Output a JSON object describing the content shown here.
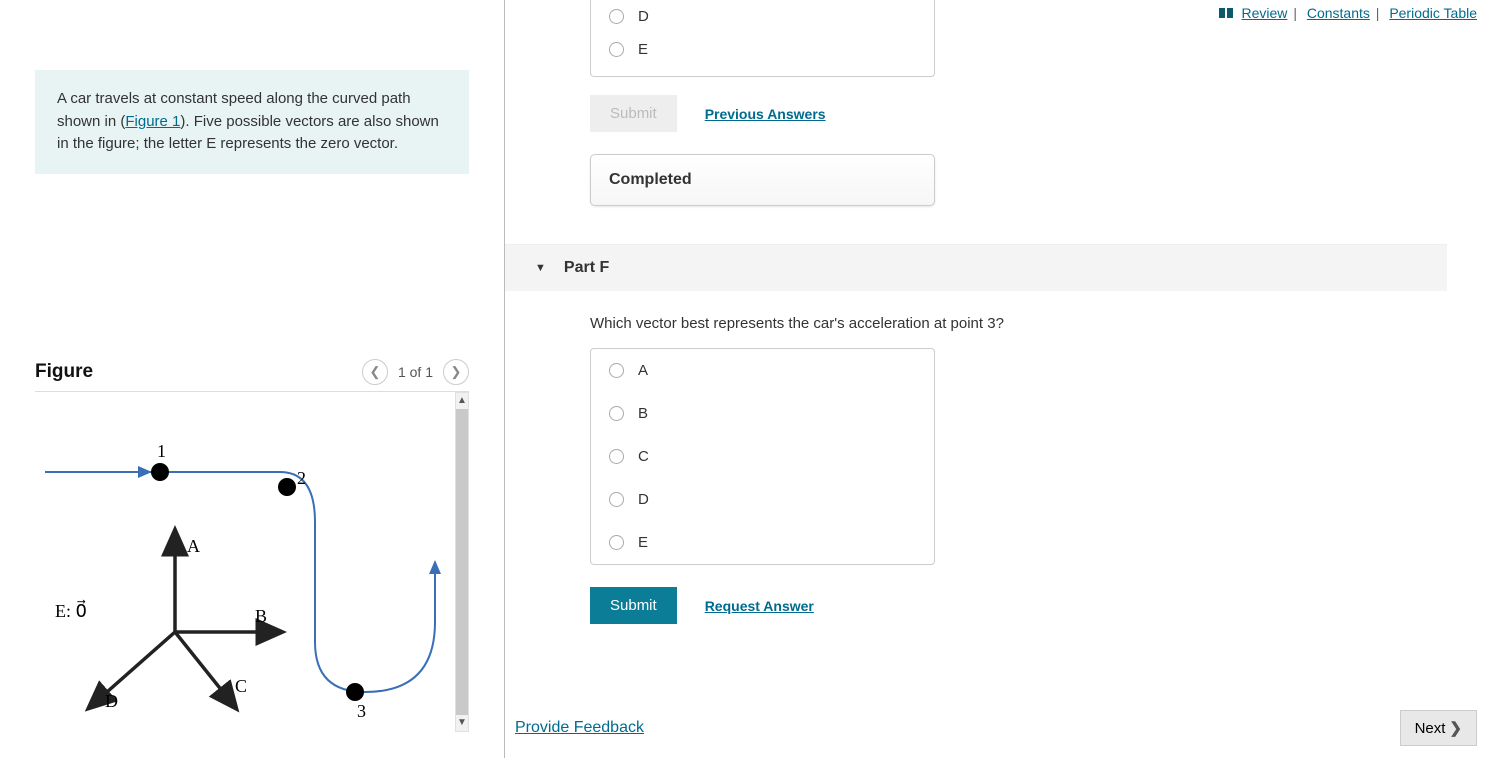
{
  "header": {
    "review": "Review",
    "constants": "Constants",
    "periodic": "Periodic Table"
  },
  "intro": {
    "textA": "A car travels at constant speed along the curved path shown in (",
    "figlink": "Figure 1",
    "textB": "). Five possible vectors are also shown in the figure; the letter E represents the zero vector."
  },
  "figure": {
    "title": "Figure",
    "page": "1 of 1",
    "labels": {
      "p1": "1",
      "p2": "2",
      "p3": "3",
      "A": "A",
      "B": "B",
      "C": "C",
      "D": "D",
      "E": "E: 0⃗"
    }
  },
  "prevPart": {
    "options": [
      "D",
      "E"
    ],
    "submit": "Submit",
    "prev_answers": "Previous Answers",
    "completed": "Completed"
  },
  "partF": {
    "title": "Part F",
    "question": "Which vector best represents the car's acceleration at point 3?",
    "options": [
      "A",
      "B",
      "C",
      "D",
      "E"
    ],
    "submit": "Submit",
    "request": "Request Answer"
  },
  "footer": {
    "feedback": "Provide Feedback",
    "next": "Next"
  }
}
